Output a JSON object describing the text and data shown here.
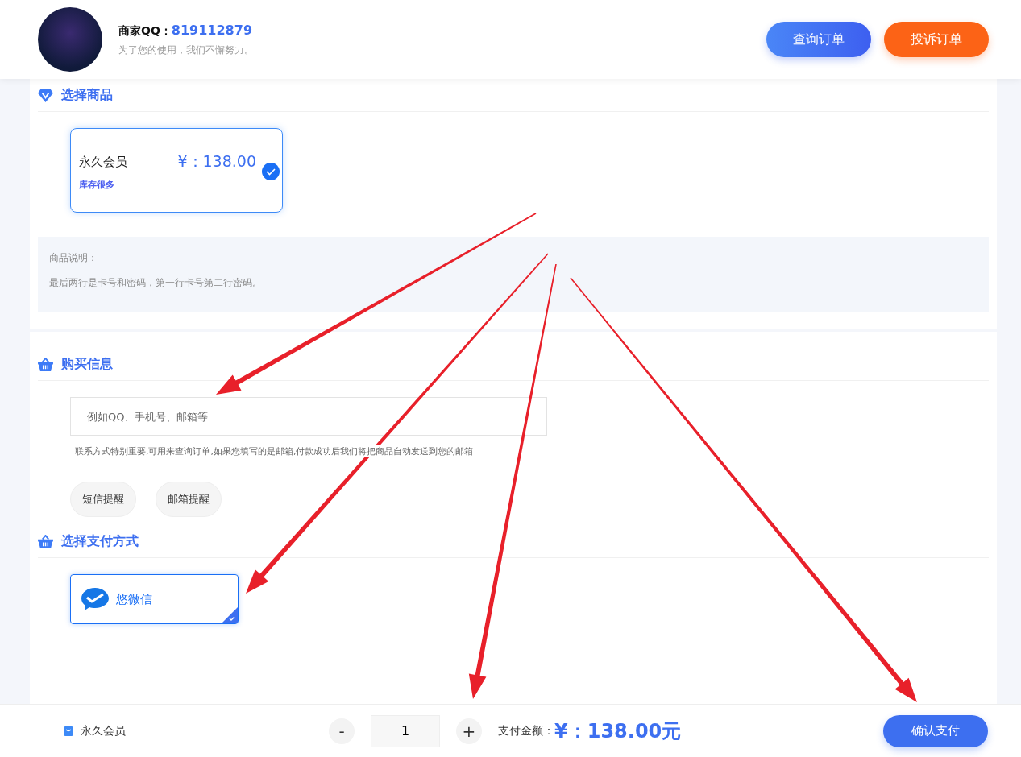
{
  "header": {
    "merchant_label": "商家QQ：",
    "merchant_qq": "819112879",
    "slogan": "为了您的使用，我们不懈努力。",
    "buttons": [
      {
        "label": "查询订单",
        "kind": "primary"
      },
      {
        "label": "投诉订单",
        "kind": "warning"
      }
    ]
  },
  "product_section": {
    "title": "选择商品",
    "products": [
      {
        "name": "永久会员",
        "price": "¥：138.00",
        "stock": "库存很多",
        "selected": true
      }
    ],
    "description": {
      "label": "商品说明：",
      "text": "最后两行是卡号和密码，第一行卡号第二行密码。"
    }
  },
  "purchase_section": {
    "title": "购买信息",
    "contact": {
      "placeholder": "例如QQ、手机号、邮箱等"
    },
    "hint": "联系方式特别重要,可用来查询订单,如果您填写的是邮箱,付款成功后我们将把商品自动发送到您的邮箱",
    "reminders": [
      {
        "label": "短信提醒",
        "selected": false
      },
      {
        "label": "邮箱提醒",
        "selected": false
      }
    ]
  },
  "payment_section": {
    "title": "选择支付方式",
    "methods": [
      {
        "name": "悠微信",
        "selected": true
      }
    ]
  },
  "bottom_bar": {
    "product": "永久会员",
    "minus": "-",
    "quantity": "1",
    "plus": "+",
    "amount_label": "支付金额：",
    "amount": "¥：138.00元",
    "confirm": "确认支付"
  }
}
